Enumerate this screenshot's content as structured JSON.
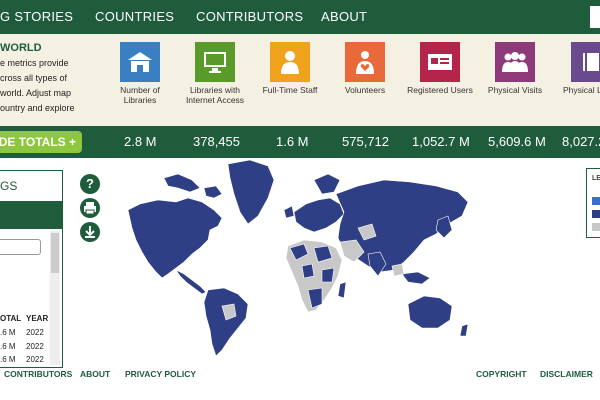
{
  "nav": {
    "items": [
      "G STORIES",
      "COUNTRIES",
      "CONTRIBUTORS",
      "ABOUT"
    ]
  },
  "intro": {
    "title": "WORLD",
    "lines": [
      "e metrics provide",
      "cross all types of",
      "world. Adjust map",
      "ountry and explore"
    ]
  },
  "metrics": [
    {
      "icon": "library-building-icon",
      "color": "#3a7fc1",
      "label": "Number of\nLibraries"
    },
    {
      "icon": "computer-icon",
      "color": "#5a9a2a",
      "label": "Libraries with\nInternet Access"
    },
    {
      "icon": "person-icon",
      "color": "#f0a21c",
      "label": "Full-Time Staff"
    },
    {
      "icon": "volunteer-heart-icon",
      "color": "#e8693a",
      "label": "Volunteers"
    },
    {
      "icon": "library-card-icon",
      "color": "#b5244a",
      "label": "Registered Users"
    },
    {
      "icon": "people-group-icon",
      "color": "#8e3a7a",
      "label": "Physical Visits"
    },
    {
      "icon": "book-icon",
      "color": "#6a4a8e",
      "label": "Physical L"
    }
  ],
  "totals": {
    "button_label": "IDE TOTALS +",
    "values": [
      "2.8 M",
      "378,455",
      "1.6 M",
      "575,712",
      "1,052.7 M",
      "5,609.6 M",
      "8,027.2"
    ]
  },
  "panel": {
    "heading": "GS",
    "headers": {
      "total": "OTAL",
      "year": "YEAR"
    },
    "rows": [
      {
        "total": ".6 M",
        "year": "2022"
      },
      {
        "total": ".6 M",
        "year": "2022"
      },
      {
        "total": ".6 M",
        "year": "2022"
      }
    ]
  },
  "side_icons": [
    "help-icon",
    "print-icon",
    "download-icon"
  ],
  "legend": {
    "title": "LE",
    "colors": [
      "#3a6fc7",
      "#2f3f86",
      "#c8c8c8"
    ]
  },
  "map_colors": {
    "data": "#2f3f86",
    "nodata": "#c8c8c8"
  },
  "footer": {
    "links": [
      "CONTRIBUTORS",
      "ABOUT",
      "PRIVACY POLICY",
      "COPYRIGHT",
      "DISCLAIMER"
    ]
  }
}
